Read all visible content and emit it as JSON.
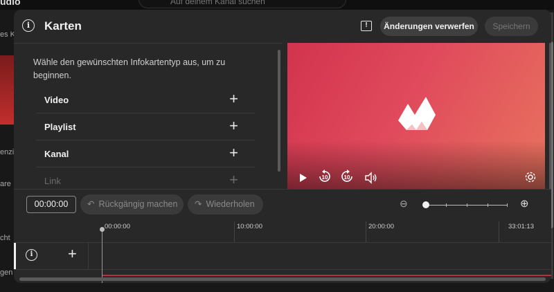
{
  "background": {
    "logo": "udio",
    "search_placeholder": "Auf deinem Kanal suchen",
    "side_items": [
      "es K",
      "enzial",
      "are",
      "cht",
      "gen"
    ]
  },
  "dialog": {
    "title": "Karten",
    "discard_label": "Änderungen verwerfen",
    "save_label": "Speichern",
    "intro": "Wähle den gewünschten Infokartentyp aus, um zu beginnen.",
    "card_types": [
      {
        "label": "Video"
      },
      {
        "label": "Playlist"
      },
      {
        "label": "Kanal"
      },
      {
        "label": "Link"
      }
    ]
  },
  "player": {
    "rewind_label": "10",
    "forward_label": "10"
  },
  "toolbar": {
    "current_time": "00:00:00",
    "undo_label": "Rückgängig machen",
    "redo_label": "Wiederholen"
  },
  "timeline": {
    "ruler": [
      "00:00:00",
      "10:00:00",
      "20:00:00",
      "33:01:13"
    ],
    "zoom_level": 0
  },
  "colors": {
    "accent_red": "#b4323f",
    "video_gradient_start": "#d2334e",
    "video_gradient_end": "#e8735e"
  }
}
